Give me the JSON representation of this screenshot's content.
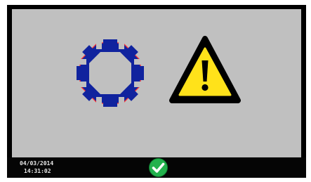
{
  "screen": {
    "background_color": "#c0c0c0",
    "status_bar_color": "#050505"
  },
  "icons": {
    "part_icon": {
      "name": "ring-part-icon",
      "fill": "#10239e",
      "outline": "#ff3030"
    },
    "warning_icon": {
      "name": "warning-icon",
      "fill": "#ffe21a",
      "border": "#000000",
      "symbol": "!"
    }
  },
  "status_bar": {
    "date": "04/03/2014",
    "time": "14:31:02",
    "ok_button": {
      "icon": "check-icon",
      "color": "#22b14c"
    }
  }
}
